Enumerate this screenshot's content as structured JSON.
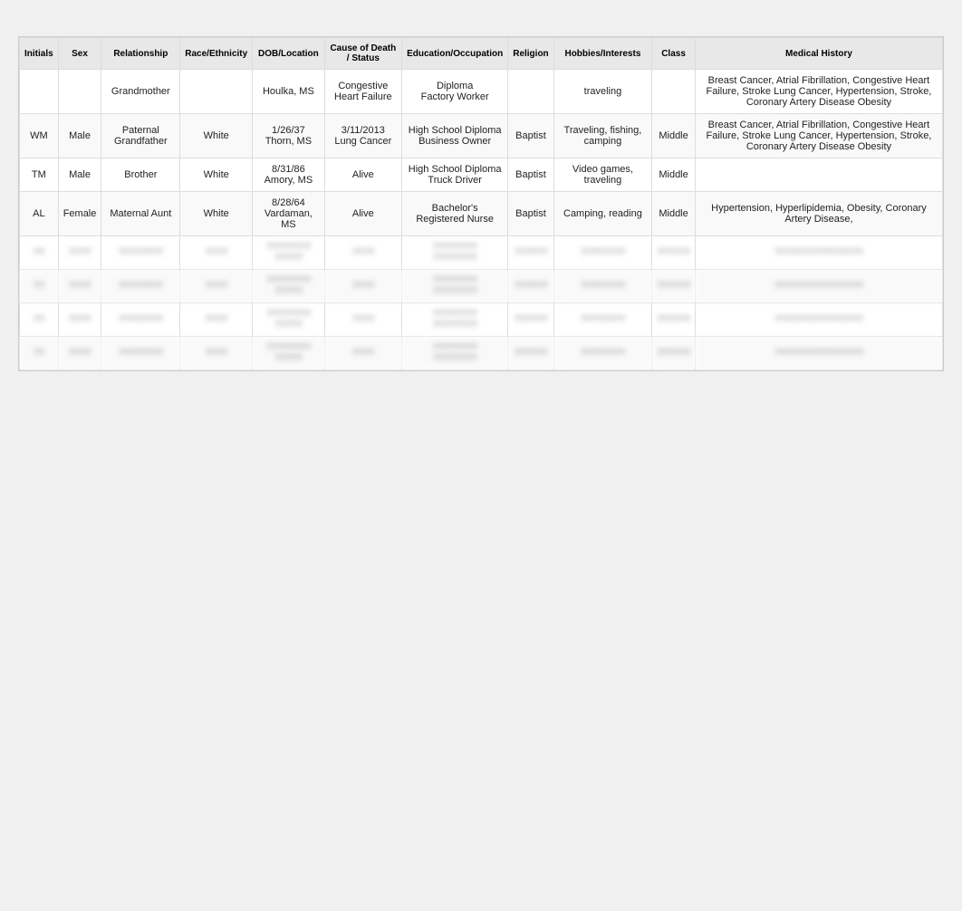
{
  "table": {
    "headers": [
      "Initials",
      "Sex",
      "Relationship",
      "Race/Ethnicity",
      "DOB/Location",
      "Cause of Death / Status",
      "Education/Occupation",
      "Religion",
      "Hobbies/Interests",
      "Class",
      "Medical History"
    ],
    "rows": [
      {
        "initials": "",
        "sex": "",
        "relationship": "Grandmother",
        "race": "",
        "dob": "Houlka, MS",
        "status": "Congestive Heart Failure",
        "edu_occ": "Diploma\nFactory Worker",
        "religion": "",
        "hobbies": "traveling",
        "class": "",
        "medical": "Breast Cancer, Atrial Fibrillation, Congestive Heart Failure, Stroke Lung Cancer, Hypertension, Stroke, Coronary Artery Disease Obesity",
        "blurred": false
      },
      {
        "initials": "WM",
        "sex": "Male",
        "relationship": "Paternal Grandfather",
        "race": "White",
        "dob": "1/26/37\nThorn, MS",
        "status": "3/11/2013\nLung Cancer",
        "edu_occ": "High School Diploma\nBusiness Owner",
        "religion": "Baptist",
        "hobbies": "Traveling, fishing, camping",
        "class": "Middle",
        "medical": "Breast Cancer, Atrial Fibrillation, Congestive Heart Failure, Stroke Lung Cancer, Hypertension, Stroke, Coronary Artery Disease Obesity",
        "blurred": false
      },
      {
        "initials": "TM",
        "sex": "Male",
        "relationship": "Brother",
        "race": "White",
        "dob": "8/31/86\nAmory, MS",
        "status": "Alive",
        "edu_occ": "High School Diploma\nTruck Driver",
        "religion": "Baptist",
        "hobbies": "Video games, traveling",
        "class": "Middle",
        "medical": "",
        "blurred": false
      },
      {
        "initials": "AL",
        "sex": "Female",
        "relationship": "Maternal Aunt",
        "race": "White",
        "dob": "8/28/64\nVardaman, MS",
        "status": "Alive",
        "edu_occ": "Bachelor's\nRegistered Nurse",
        "religion": "Baptist",
        "hobbies": "Camping, reading",
        "class": "Middle",
        "medical": "Hypertension, Hyperlipidemia, Obesity, Coronary Artery Disease,",
        "blurred": false
      },
      {
        "initials": "??",
        "sex": "????",
        "relationship": "????????",
        "race": "????",
        "dob": "????????\n?????",
        "status": "????",
        "edu_occ": "????????\n????????",
        "religion": "??????",
        "hobbies": "????????",
        "class": "??????",
        "medical": "????????????????",
        "blurred": true
      },
      {
        "initials": "??",
        "sex": "????",
        "relationship": "????????",
        "race": "????",
        "dob": "????????\n?????",
        "status": "????",
        "edu_occ": "????????\n????????",
        "religion": "??????",
        "hobbies": "????????",
        "class": "??????",
        "medical": "????????????????",
        "blurred": true
      },
      {
        "initials": "??",
        "sex": "????",
        "relationship": "????????",
        "race": "????",
        "dob": "????????\n?????",
        "status": "????",
        "edu_occ": "????????\n????????",
        "religion": "??????",
        "hobbies": "????????",
        "class": "??????",
        "medical": "????????????????",
        "blurred": true
      },
      {
        "initials": "??",
        "sex": "????",
        "relationship": "????????",
        "race": "????",
        "dob": "????????\n?????",
        "status": "????",
        "edu_occ": "????????\n????????",
        "religion": "??????",
        "hobbies": "????????",
        "class": "??????",
        "medical": "????????????????",
        "blurred": true
      }
    ]
  }
}
